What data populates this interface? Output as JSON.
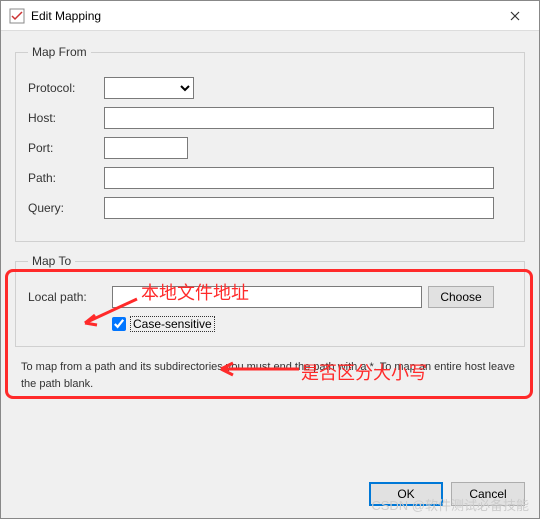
{
  "titlebar": {
    "title": "Edit Mapping"
  },
  "map_from": {
    "legend": "Map From",
    "protocol_label": "Protocol:",
    "protocol_value": "",
    "host_label": "Host:",
    "host_value": "",
    "port_label": "Port:",
    "port_value": "",
    "path_label": "Path:",
    "path_value": "",
    "query_label": "Query:",
    "query_value": ""
  },
  "map_to": {
    "legend": "Map To",
    "localpath_label": "Local path:",
    "localpath_value": "",
    "choose_label": "Choose",
    "case_sensitive_label": "Case-sensitive",
    "case_sensitive_checked": true
  },
  "help_text": "To map from a path and its subdirectories you must end the path with a *. To map an entire host leave the path blank.",
  "buttons": {
    "ok": "OK",
    "cancel": "Cancel"
  },
  "annotations": {
    "local_file_address": "本地文件地址",
    "case_sensitive_note": "是否区分大小写"
  },
  "watermark": "CSDN @软件测试必备技能"
}
